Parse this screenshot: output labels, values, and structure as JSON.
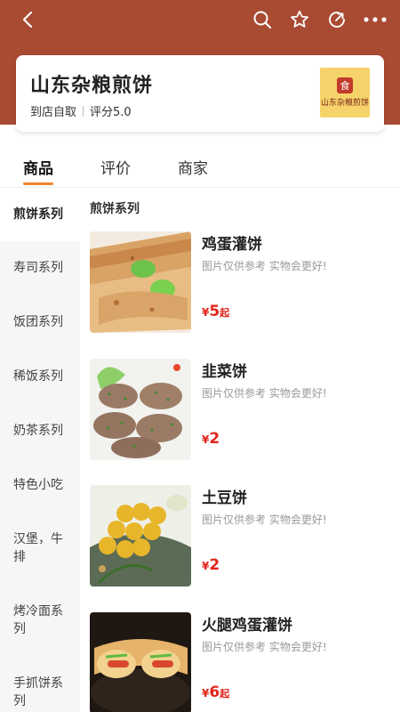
{
  "store": {
    "name": "山东杂粮煎饼",
    "pickup": "到店自取",
    "rating": "评分5.0",
    "logo_text": "山东杂粮煎饼"
  },
  "tabs": [
    {
      "label": "商品",
      "active": true
    },
    {
      "label": "评价",
      "active": false
    },
    {
      "label": "商家",
      "active": false
    }
  ],
  "sidebar": {
    "items": [
      {
        "label": "煎饼系列",
        "active": true
      },
      {
        "label": "寿司系列"
      },
      {
        "label": "饭团系列"
      },
      {
        "label": "稀饭系列"
      },
      {
        "label": "奶茶系列"
      },
      {
        "label": "特色小吃"
      },
      {
        "label": "汉堡，牛排"
      },
      {
        "label": "烤冷面系列"
      },
      {
        "label": "手抓饼系列"
      }
    ]
  },
  "section": {
    "title": "煎饼系列"
  },
  "dishes": [
    {
      "name": "鸡蛋灌饼",
      "desc": "图片仅供参考 实物会更好!",
      "currency": "¥",
      "price": "5",
      "suffix": "起"
    },
    {
      "name": "韭菜饼",
      "desc": "图片仅供参考 实物会更好!",
      "currency": "¥",
      "price": "2",
      "suffix": ""
    },
    {
      "name": "土豆饼",
      "desc": "图片仅供参考 实物会更好!",
      "currency": "¥",
      "price": "2",
      "suffix": ""
    },
    {
      "name": "火腿鸡蛋灌饼",
      "desc": "图片仅供参考 实物会更好!",
      "currency": "¥",
      "price": "6",
      "suffix": "起"
    }
  ],
  "colors": {
    "header": "#a94a33",
    "accent": "#f0852f",
    "price": "#e1251b"
  },
  "icons": [
    "back-icon",
    "search-icon",
    "star-icon",
    "share-icon",
    "more-icon"
  ]
}
